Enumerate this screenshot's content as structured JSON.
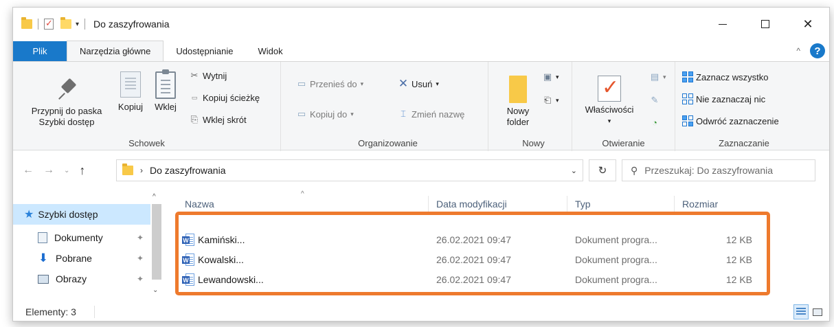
{
  "window": {
    "title": "Do zaszyfrowania",
    "qa_dropdown": "▾",
    "minimize_label": "",
    "close_label": "✕"
  },
  "tabs": [
    {
      "label": "Plik"
    },
    {
      "label": "Narzędzia główne"
    },
    {
      "label": "Udostępnianie"
    },
    {
      "label": "Widok"
    }
  ],
  "ribbon": {
    "schowek": {
      "label": "Schowek",
      "pin": "Przypnij do paska Szybki dostęp",
      "copy": "Kopiuj",
      "paste": "Wklej",
      "cut": "Wytnij",
      "copy_path": "Kopiuj ścieżkę",
      "paste_shortcut": "Wklej skrót"
    },
    "organizowanie": {
      "label": "Organizowanie",
      "move_to": "Przenieś do",
      "copy_to": "Kopiuj do",
      "delete": "Usuń",
      "rename": "Zmień nazwę"
    },
    "nowy": {
      "label": "Nowy",
      "new_folder": "Nowy folder"
    },
    "otwieranie": {
      "label": "Otwieranie",
      "properties": "Właściwości"
    },
    "zaznaczanie": {
      "label": "Zaznaczanie",
      "select_all": "Zaznacz wszystko",
      "select_none": "Nie zaznaczaj nic",
      "invert": "Odwróć zaznaczenie"
    }
  },
  "address": {
    "path": "Do zaszyfrowania",
    "search_placeholder": "Przeszukaj: Do zaszyfrowania"
  },
  "nav_pane": [
    {
      "label": "Szybki dostęp"
    },
    {
      "label": "Dokumenty"
    },
    {
      "label": "Pobrane"
    },
    {
      "label": "Obrazy"
    }
  ],
  "columns": {
    "name": "Nazwa",
    "date": "Data modyfikacji",
    "type": "Typ",
    "size": "Rozmiar"
  },
  "files": [
    {
      "name": "Kamiński...",
      "date": "26.02.2021 09:47",
      "type": "Dokument progra...",
      "size": "12 KB"
    },
    {
      "name": "Kowalski...",
      "date": "26.02.2021 09:47",
      "type": "Dokument progra...",
      "size": "12 KB"
    },
    {
      "name": "Lewandowski...",
      "date": "26.02.2021 09:47",
      "type": "Dokument progra...",
      "size": "12 KB"
    }
  ],
  "status": {
    "items": "Elementy: 3"
  },
  "colors": {
    "accent": "#1979ca",
    "highlight": "#ee7a2d",
    "folder": "#f8c948"
  }
}
